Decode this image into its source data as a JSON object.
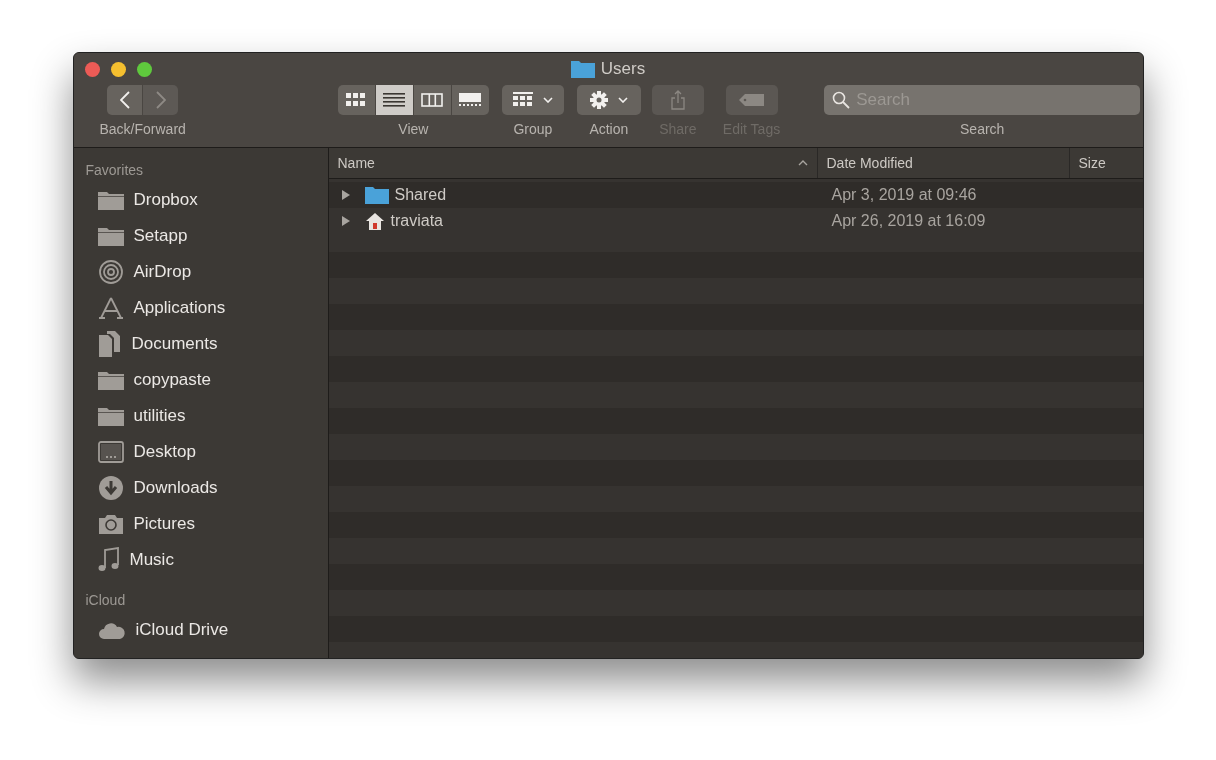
{
  "window": {
    "title": "Users"
  },
  "toolbar": {
    "nav": {
      "label": "Back/Forward",
      "back_disabled": false,
      "forward_disabled": true
    },
    "view": {
      "label": "View",
      "modes": [
        {
          "kind": "icons",
          "selected": false
        },
        {
          "kind": "list",
          "selected": true
        },
        {
          "kind": "columns",
          "selected": false
        },
        {
          "kind": "gallery",
          "selected": false
        }
      ]
    },
    "tools": [
      {
        "kind": "group",
        "label": "Group",
        "disabled": false
      },
      {
        "kind": "action",
        "label": "Action",
        "disabled": false
      },
      {
        "kind": "share",
        "label": "Share",
        "disabled": true
      },
      {
        "kind": "tags",
        "label": "Edit Tags",
        "disabled": true
      }
    ],
    "search": {
      "placeholder": "Search",
      "label": "Search"
    }
  },
  "sidebar": {
    "sections": [
      {
        "title": "Favorites",
        "items": [
          {
            "label": "Dropbox",
            "kind": "folder"
          },
          {
            "label": "Setapp",
            "kind": "folder"
          },
          {
            "label": "AirDrop",
            "kind": "airdrop"
          },
          {
            "label": "Applications",
            "kind": "apps"
          },
          {
            "label": "Documents",
            "kind": "docs"
          },
          {
            "label": "copypaste",
            "kind": "folder"
          },
          {
            "label": "utilities",
            "kind": "folder"
          },
          {
            "label": "Desktop",
            "kind": "desktop"
          },
          {
            "label": "Downloads",
            "kind": "downloads"
          },
          {
            "label": "Pictures",
            "kind": "pictures"
          },
          {
            "label": "Music",
            "kind": "music"
          }
        ]
      },
      {
        "title": "iCloud",
        "items": [
          {
            "label": "iCloud Drive",
            "kind": "cloud"
          }
        ]
      }
    ]
  },
  "table": {
    "columns": [
      {
        "label": "Name",
        "sorted": true
      },
      {
        "label": "Date Modified",
        "sorted": false
      },
      {
        "label": "Size",
        "sorted": false
      }
    ],
    "rows": [
      {
        "name": "Shared",
        "kind": "folder",
        "date": "Apr 3, 2019 at 09:46",
        "expanded": false
      },
      {
        "name": "traviata",
        "kind": "home",
        "date": "Apr 26, 2019 at 16:09",
        "expanded": false
      }
    ]
  }
}
